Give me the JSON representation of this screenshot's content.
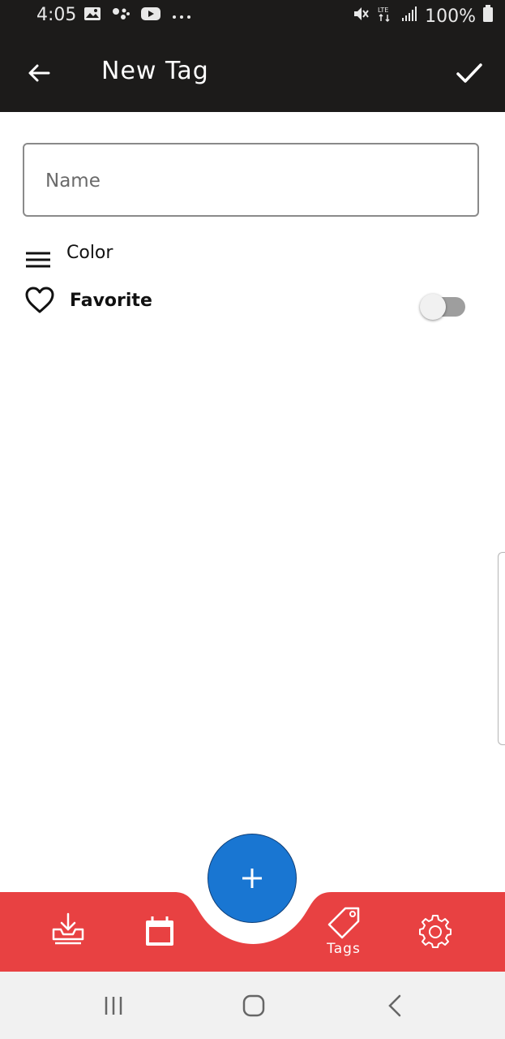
{
  "status_bar": {
    "time": "4:05",
    "battery": "100%",
    "network": "LTE",
    "left_icons": [
      "gallery-icon",
      "assistant-icon",
      "youtube-icon",
      "more-dots-icon"
    ],
    "right_icons": [
      "mute-icon",
      "lte-icon",
      "signal-icon",
      "battery-icon"
    ]
  },
  "app_bar": {
    "title": "New Tag",
    "back_icon": "arrow-back-icon",
    "confirm_icon": "check-icon"
  },
  "form": {
    "name_placeholder": "Name",
    "name_value": "",
    "color_label": "Color",
    "favorite_label": "Favorite",
    "favorite_enabled": false
  },
  "bottom_nav": {
    "items": [
      {
        "name": "inbox",
        "icon": "inbox-download-icon",
        "label": ""
      },
      {
        "name": "calendar",
        "icon": "calendar-icon",
        "label": ""
      },
      {
        "name": "tags",
        "icon": "tag-icon",
        "label": "Tags"
      },
      {
        "name": "settings",
        "icon": "gear-icon",
        "label": ""
      }
    ],
    "fab_icon": "plus-icon"
  },
  "colors": {
    "app_bar_bg": "#1c1b1a",
    "bottom_bar_bg": "#e84142",
    "fab_bg": "#1976d2",
    "system_nav_bg": "#f1f1f1"
  }
}
